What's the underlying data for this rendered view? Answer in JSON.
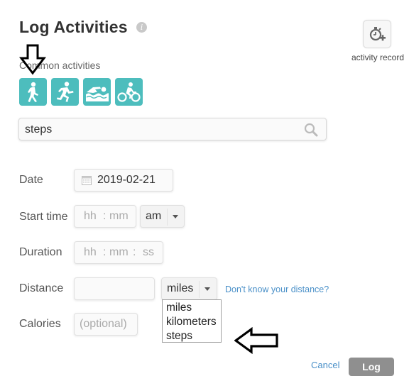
{
  "header": {
    "title": "Log Activities",
    "info_icon": "info-icon",
    "activity_record": {
      "icon": "stopwatch-plus-icon",
      "label": "activity record"
    }
  },
  "common_activities": {
    "label": "Common activities",
    "items": [
      {
        "name": "walk",
        "icon": "walking-icon"
      },
      {
        "name": "run",
        "icon": "running-icon"
      },
      {
        "name": "swim",
        "icon": "swimming-icon"
      },
      {
        "name": "bike",
        "icon": "cycling-icon"
      }
    ],
    "accent_color": "#4dbdbd"
  },
  "search": {
    "value": "steps",
    "icon": "search-icon"
  },
  "form": {
    "date": {
      "label": "Date",
      "value": "2019-02-21",
      "icon": "calendar-icon"
    },
    "start_time": {
      "label": "Start time",
      "hh": "hh",
      "sep": ":",
      "mm": "mm",
      "ampm": "am"
    },
    "duration": {
      "label": "Duration",
      "hh": "hh",
      "sep1": ":",
      "mm": "mm",
      "sep2": ":",
      "ss": "ss"
    },
    "distance": {
      "label": "Distance",
      "value": "",
      "unit": "miles",
      "unit_options": [
        "miles",
        "kilometers",
        "steps"
      ],
      "help_link": "Don't know your distance?"
    },
    "calories": {
      "label": "Calories",
      "placeholder": "(optional)"
    }
  },
  "actions": {
    "cancel": "Cancel",
    "log": "Log"
  },
  "annotations": {
    "arrow_down": "arrow-down-annotation",
    "arrow_left": "arrow-left-annotation"
  }
}
